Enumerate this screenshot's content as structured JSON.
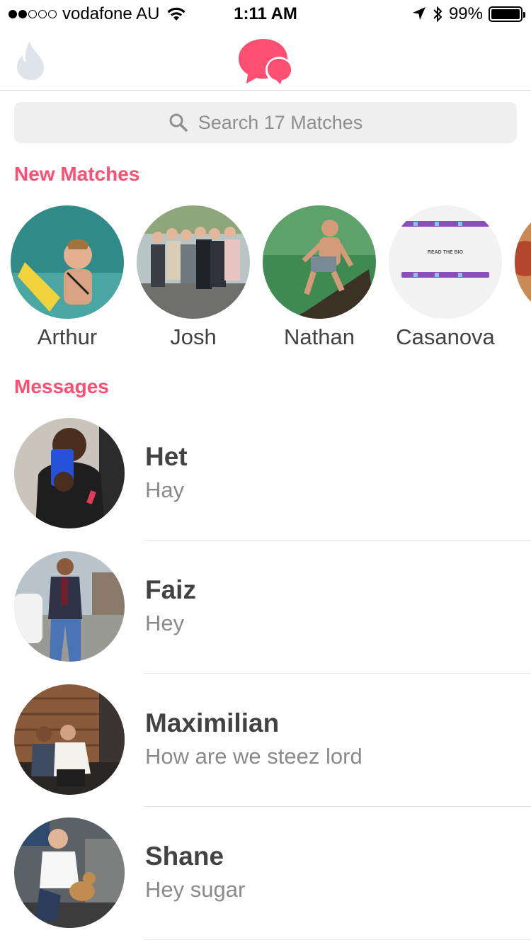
{
  "status_bar": {
    "carrier": "vodafone AU",
    "time": "1:11 AM",
    "battery": "99%",
    "battery_level": 0.99,
    "signal_bars_filled": 2,
    "signal_bars_total": 5
  },
  "nav": {
    "left_icon": "flame-icon",
    "center_icon": "chat-bubbles-icon",
    "accent_color": "#fd4f72",
    "inactive_color": "#dfe3ea"
  },
  "search": {
    "placeholder": "Search 17 Matches"
  },
  "new_matches": {
    "title": "New Matches",
    "items": [
      {
        "name": "Arthur"
      },
      {
        "name": "Josh"
      },
      {
        "name": "Nathan"
      },
      {
        "name": "Casanova",
        "avatar_text": "READ THE BIO"
      },
      {
        "name": ""
      }
    ]
  },
  "messages": {
    "title": "Messages",
    "items": [
      {
        "name": "Het",
        "text": "Hay"
      },
      {
        "name": "Faiz",
        "text": "Hey"
      },
      {
        "name": "Maximilian",
        "text": "How are we steez lord"
      },
      {
        "name": "Shane",
        "text": "Hey sugar"
      }
    ]
  }
}
